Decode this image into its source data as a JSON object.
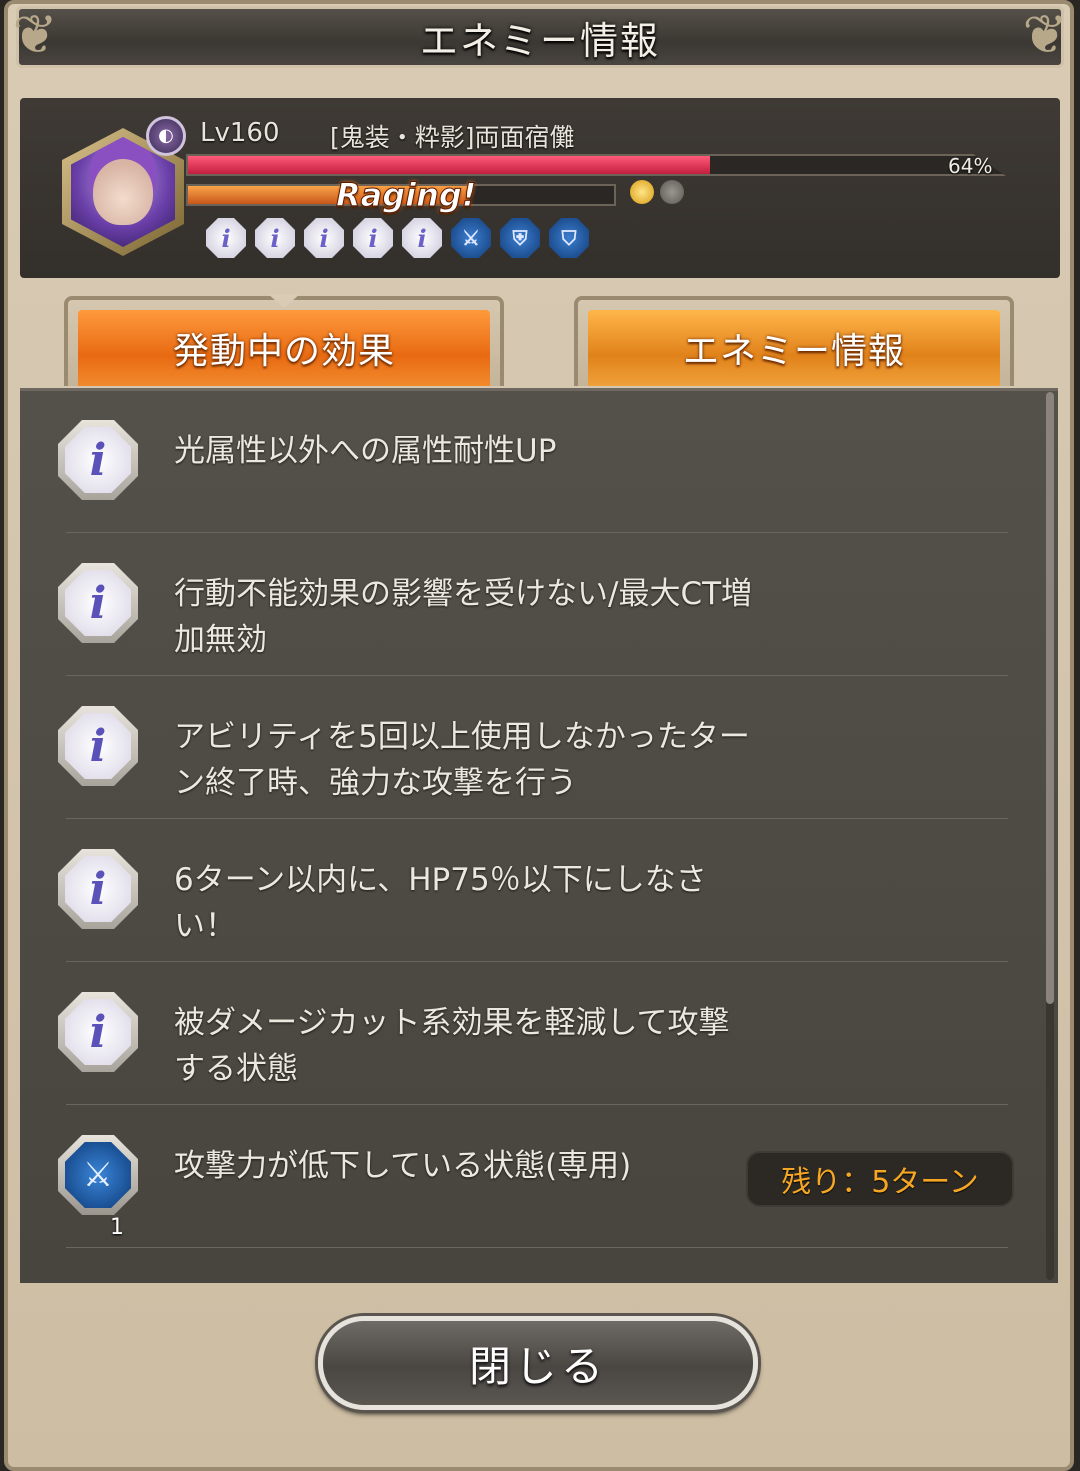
{
  "window": {
    "title": "エネミー情報"
  },
  "enemy": {
    "level": "Lv160",
    "name": "[鬼装・粋影]両面宿儺",
    "hp_percent_label": "64%",
    "hp_fraction": 0.64,
    "ct_fraction": 0.66,
    "raging_label": "Raging!",
    "element_icon": "dark-element-icon",
    "status_icons": [
      "info-icon",
      "info-icon",
      "info-icon",
      "info-icon",
      "info-icon",
      "attack-down-icon",
      "defense-down-icon",
      "shield-down-icon"
    ]
  },
  "tabs": {
    "active_effects": "発動中の効果",
    "enemy_info": "エネミー情報"
  },
  "effects": [
    {
      "icon": "info-icon",
      "text": "光属性以外への属性耐性UP"
    },
    {
      "icon": "info-icon",
      "text": "行動不能効果の影響を受けない/最大CT増加無効"
    },
    {
      "icon": "info-icon",
      "text": "アビリティを5回以上使用しなかったターン終了時、強力な攻撃を行う"
    },
    {
      "icon": "info-icon",
      "text": "6ターン以内に、HP75％以下にしなさい！"
    },
    {
      "icon": "info-icon",
      "text": "被ダメージカット系効果を軽減して攻撃する状態"
    },
    {
      "icon": "attack-down-icon",
      "text": "攻撃力が低下している状態(専用)",
      "stack": "1",
      "remaining": "残り：5ターン"
    }
  ],
  "footer": {
    "close_label": "閉じる"
  },
  "colors": {
    "accent_orange": "#e86a12",
    "hp_red": "#c21e3e",
    "remain_text": "#f5a623"
  }
}
